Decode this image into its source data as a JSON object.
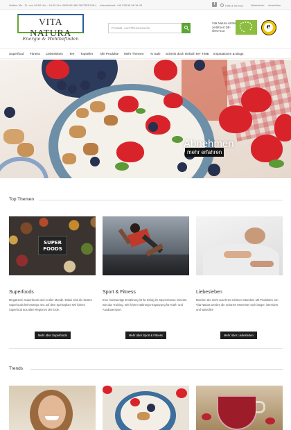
{
  "topbar": {
    "hours": "Hotline Mo - Fr: von 09:00 Uhr - 16:00 Uhr: 0800 66 480 28 FREECALL",
    "international": "International: +49 228 55 08 16 43",
    "facebook_glyph": "f",
    "help": "Hilfe & Service",
    "cart": "Warenkorb",
    "login": "Anmelden"
  },
  "header": {
    "logo_name": "VITA NATURA",
    "logo_tagline": "Energie & Wohlbefinden",
    "search_placeholder": "Produkt- und Themensuche",
    "bio_text": "Vita Natura ist Bio-zertifiziert DE-ÖKO-013",
    "trust_glyph": "e"
  },
  "nav": {
    "items": [
      "Superfood",
      "Fitness",
      "Liebesleben",
      "Tee",
      "Topseller",
      "Alle Produkte",
      "Mehr Themen",
      "% Sale",
      "Schenk doch einfach MY TIME",
      "Inspirationen & Blogs"
    ]
  },
  "hero": {
    "title": "Abnehmen",
    "cta": "mehr erfahren"
  },
  "top_themen": {
    "heading": "Top Themen",
    "cards": [
      {
        "title": "Superfoods",
        "badge": "SUPER FOODS",
        "text": "Megatrend: Superfoods sind in aller Munde. Dabei sind die besten Superfoods keineswegs neu auf dem Speiseplan! Wir führen Superfood aus allen Regionen der Erde.",
        "button": "Mehr über Superfoods"
      },
      {
        "title": "Sport & Fitness",
        "text": "Eine hochwertige Ernährung ist für Erfolg im Sport ebenso relevant wie das Training. Wir führen Nahrungs-Ergänzung für Kraft- und Ausdauersport.",
        "button": "Mehr über Sport & Fitness"
      },
      {
        "title": "Liebesleben",
        "text": "Machen Sie mehr aus Ihren schönen Stunden! Mit Produkten von Vita Natura werden die schönen Momente noch länger, intensiver und lustvoller!",
        "button": "Mehr über Liebesleben"
      }
    ]
  },
  "trends": {
    "heading": "Trends"
  },
  "colors": {
    "brand_green": "#5aa634",
    "brand_blue": "#2c5c9a",
    "button_dark": "#1f1f1f"
  }
}
